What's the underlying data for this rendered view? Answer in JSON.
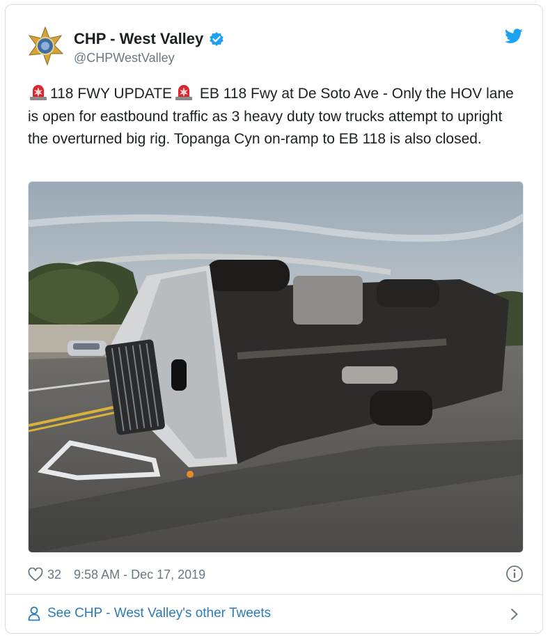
{
  "tweet": {
    "author_name": "CHP - West Valley",
    "author_handle": "@CHPWestValley",
    "text_part1": "118 FWY UPDATE",
    "text_part2": " EB 118 Fwy at De Soto Ave - Only the HOV lane is open for eastbound traffic as 3 heavy duty tow trucks attempt to upright the overturned big rig. Topanga Cyn on-ramp to EB 118 is also closed.",
    "likes": "32",
    "timestamp": "9:58 AM - Dec 17, 2019"
  },
  "footer": {
    "link_text": "See CHP - West Valley's other Tweets"
  },
  "icons": {
    "avatar": "chp-badge-icon",
    "verified": "verified-badge-icon",
    "platform": "twitter-bird-icon",
    "siren": "rotating-light-emoji",
    "like": "heart-icon",
    "info": "info-icon",
    "profile": "person-icon",
    "chevron": "chevron-right-icon"
  },
  "colors": {
    "link_blue": "#2b7bb9",
    "twitter_blue": "#1da1f2",
    "muted_text": "#697882",
    "body_text": "#1c2022"
  }
}
